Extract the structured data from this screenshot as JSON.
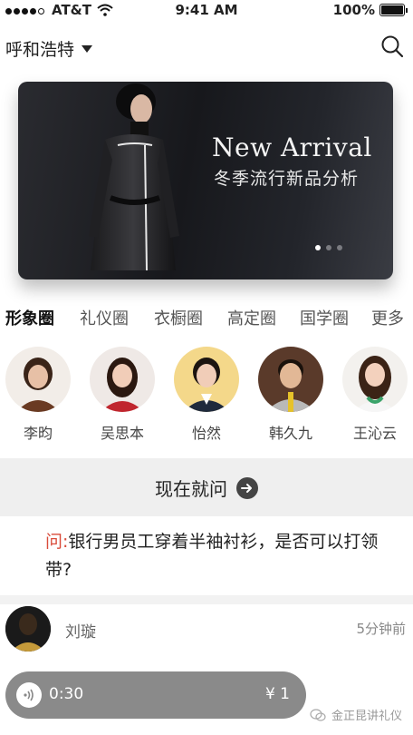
{
  "status": {
    "carrier": "AT&T",
    "time": "9:41 AM",
    "battery": "100%"
  },
  "topbar": {
    "city": "呼和浩特"
  },
  "banner": {
    "title": "New Arrival",
    "subtitle": "冬季流行新品分析",
    "pages": 3,
    "active_page": 1
  },
  "tabs": [
    {
      "label": "形象圈"
    },
    {
      "label": "礼仪圈"
    },
    {
      "label": "衣橱圈"
    },
    {
      "label": "高定圈"
    },
    {
      "label": "国学圈"
    },
    {
      "label": "更多"
    }
  ],
  "people": [
    {
      "name": "李昀"
    },
    {
      "name": "吴思本"
    },
    {
      "name": "怡然"
    },
    {
      "name": "韩久九"
    },
    {
      "name": "王沁云"
    }
  ],
  "ask": {
    "label": "现在就问"
  },
  "question": {
    "prefix": "问:",
    "text": "银行男员工穿着半袖衬衫，是否可以打领带?"
  },
  "answer": {
    "user": "刘璇",
    "time": "5分钟前",
    "duration": "0:30",
    "price": "¥ 1"
  },
  "watermark": {
    "text": "金正昆讲礼仪"
  },
  "colors": {
    "accent": "#d94b3a",
    "voice_bg": "#8a8a8a"
  }
}
